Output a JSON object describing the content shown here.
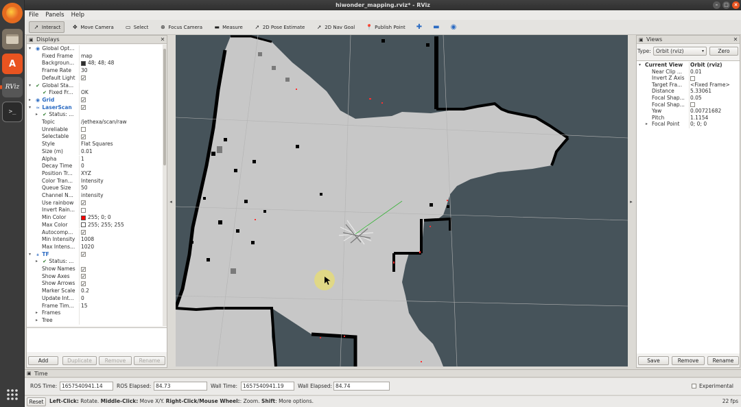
{
  "window": {
    "title": "hiwonder_mapping.rviz* - RViz"
  },
  "menu": [
    "File",
    "Panels",
    "Help"
  ],
  "toolbar": [
    {
      "label": "Interact",
      "icon": "cursor-icon",
      "glyph": "➚",
      "active": true
    },
    {
      "label": "Move Camera",
      "icon": "move-icon",
      "glyph": "✥",
      "active": false
    },
    {
      "label": "Select",
      "icon": "select-icon",
      "glyph": "▭",
      "active": false
    },
    {
      "label": "Focus Camera",
      "icon": "focus-icon",
      "glyph": "⊕",
      "active": false
    },
    {
      "label": "Measure",
      "icon": "ruler-icon",
      "glyph": "▬",
      "active": false
    },
    {
      "label": "2D Pose Estimate",
      "icon": "pose-arrow-icon",
      "glyph": "➚",
      "active": false
    },
    {
      "label": "2D Nav Goal",
      "icon": "goal-arrow-icon",
      "glyph": "➚",
      "active": false
    },
    {
      "label": "Publish Point",
      "icon": "pin-icon",
      "glyph": "📍",
      "active": false
    }
  ],
  "displays": {
    "title": "Displays",
    "rows": [
      {
        "indent": 0,
        "arrow": "▾",
        "icon": "◉",
        "label": "Global Opt...",
        "value": "",
        "kind": "text"
      },
      {
        "indent": 1,
        "label": "Fixed Frame",
        "value": "map",
        "kind": "text"
      },
      {
        "indent": 1,
        "label": "Backgroun...",
        "value": "48; 48; 48",
        "kind": "color",
        "color": "#303030"
      },
      {
        "indent": 1,
        "label": "Frame Rate",
        "value": "30",
        "kind": "text"
      },
      {
        "indent": 1,
        "label": "Default Light",
        "value": "",
        "kind": "check",
        "checked": true
      },
      {
        "indent": 0,
        "arrow": "▾",
        "icon": "✔",
        "label": "Global Sta...",
        "value": "",
        "kind": "text"
      },
      {
        "indent": 1,
        "icon": "✔",
        "label": "Fixed Fr...",
        "value": "OK",
        "kind": "text"
      },
      {
        "indent": 0,
        "arrow": "▸",
        "icon": "◉",
        "label": "Grid",
        "value": "",
        "kind": "check",
        "checked": true,
        "blue": true
      },
      {
        "indent": 0,
        "arrow": "▾",
        "icon": "≈",
        "label": "LaserScan",
        "value": "",
        "kind": "check",
        "checked": true,
        "blue": true
      },
      {
        "indent": 1,
        "arrow": "▸",
        "icon": "✔",
        "label": "Status: ...",
        "value": "",
        "kind": "text"
      },
      {
        "indent": 1,
        "label": "Topic",
        "value": "/jethexa/scan/raw",
        "kind": "text"
      },
      {
        "indent": 1,
        "label": "Unreliable",
        "value": "",
        "kind": "check",
        "checked": false
      },
      {
        "indent": 1,
        "label": "Selectable",
        "value": "",
        "kind": "check",
        "checked": true
      },
      {
        "indent": 1,
        "label": "Style",
        "value": "Flat Squares",
        "kind": "text"
      },
      {
        "indent": 1,
        "label": "Size (m)",
        "value": "0.01",
        "kind": "text"
      },
      {
        "indent": 1,
        "label": "Alpha",
        "value": "1",
        "kind": "text"
      },
      {
        "indent": 1,
        "label": "Decay Time",
        "value": "0",
        "kind": "text"
      },
      {
        "indent": 1,
        "label": "Position Tr...",
        "value": "XYZ",
        "kind": "text"
      },
      {
        "indent": 1,
        "label": "Color Tran...",
        "value": "Intensity",
        "kind": "text"
      },
      {
        "indent": 1,
        "label": "Queue Size",
        "value": "50",
        "kind": "text"
      },
      {
        "indent": 1,
        "label": "Channel N...",
        "value": "intensity",
        "kind": "text"
      },
      {
        "indent": 1,
        "label": "Use rainbow",
        "value": "",
        "kind": "check",
        "checked": true
      },
      {
        "indent": 1,
        "label": "Invert Rain...",
        "value": "",
        "kind": "check",
        "checked": false
      },
      {
        "indent": 1,
        "label": "Min Color",
        "value": "255; 0; 0",
        "kind": "color",
        "color": "#ff0000"
      },
      {
        "indent": 1,
        "label": "Max Color",
        "value": "255; 255; 255",
        "kind": "color",
        "color": "#ffffff"
      },
      {
        "indent": 1,
        "label": "Autocomp...",
        "value": "",
        "kind": "check",
        "checked": true
      },
      {
        "indent": 1,
        "label": "Min Intensity",
        "value": "1008",
        "kind": "text"
      },
      {
        "indent": 1,
        "label": "Max Intens...",
        "value": "1020",
        "kind": "text"
      },
      {
        "indent": 0,
        "arrow": "▾",
        "icon": "⚹",
        "label": "TF",
        "value": "",
        "kind": "check",
        "checked": true,
        "blue": true
      },
      {
        "indent": 1,
        "arrow": "▸",
        "icon": "✔",
        "label": "Status: ...",
        "value": "",
        "kind": "text"
      },
      {
        "indent": 1,
        "label": "Show Names",
        "value": "",
        "kind": "check",
        "checked": true
      },
      {
        "indent": 1,
        "label": "Show Axes",
        "value": "",
        "kind": "check",
        "checked": true
      },
      {
        "indent": 1,
        "label": "Show Arrows",
        "value": "",
        "kind": "check",
        "checked": true
      },
      {
        "indent": 1,
        "label": "Marker Scale",
        "value": "0.2",
        "kind": "text"
      },
      {
        "indent": 1,
        "label": "Update Int...",
        "value": "0",
        "kind": "text"
      },
      {
        "indent": 1,
        "label": "Frame Tim...",
        "value": "15",
        "kind": "text"
      },
      {
        "indent": 1,
        "arrow": "▸",
        "label": "Frames",
        "value": "",
        "kind": "text"
      },
      {
        "indent": 1,
        "arrow": "▸",
        "label": "Tree",
        "value": "",
        "kind": "text"
      }
    ],
    "buttons": {
      "add": "Add",
      "duplicate": "Duplicate",
      "remove": "Remove",
      "rename": "Rename"
    }
  },
  "views": {
    "title": "Views",
    "type_label": "Type:",
    "type_value": "Orbit (rviz)",
    "zero": "Zero",
    "rows": [
      {
        "indent": 0,
        "arrow": "▾",
        "label": "Current View",
        "value": "Orbit (rviz)",
        "kind": "text",
        "bold": true
      },
      {
        "indent": 1,
        "label": "Near Clip ...",
        "value": "0.01",
        "kind": "text"
      },
      {
        "indent": 1,
        "label": "Invert Z Axis",
        "value": "",
        "kind": "check",
        "checked": false
      },
      {
        "indent": 1,
        "label": "Target Fra...",
        "value": "<Fixed Frame>",
        "kind": "text"
      },
      {
        "indent": 1,
        "label": "Distance",
        "value": "5.33061",
        "kind": "text"
      },
      {
        "indent": 1,
        "label": "Focal Shap...",
        "value": "0.05",
        "kind": "text"
      },
      {
        "indent": 1,
        "label": "Focal Shap...",
        "value": "",
        "kind": "check",
        "checked": false
      },
      {
        "indent": 1,
        "label": "Yaw",
        "value": "0.00721682",
        "kind": "text"
      },
      {
        "indent": 1,
        "label": "Pitch",
        "value": "1.1154",
        "kind": "text"
      },
      {
        "indent": 1,
        "arrow": "▸",
        "label": "Focal Point",
        "value": "0; 0; 0",
        "kind": "text"
      }
    ],
    "buttons": {
      "save": "Save",
      "remove": "Remove",
      "rename": "Rename"
    }
  },
  "time": {
    "title": "Time",
    "ros_time_label": "ROS Time:",
    "ros_time": "1657540941.14",
    "ros_elapsed_label": "ROS Elapsed:",
    "ros_elapsed": "84.73",
    "wall_time_label": "Wall Time:",
    "wall_time": "1657540941.19",
    "wall_elapsed_label": "Wall Elapsed:",
    "wall_elapsed": "84.74",
    "experimental": "Experimental"
  },
  "status": {
    "reset": "Reset",
    "lc_key": "Left-Click:",
    "lc_text": " Rotate. ",
    "mc_key": "Middle-Click:",
    "mc_text": " Move X/Y. ",
    "rc_key": "Right-Click/Mouse Wheel:",
    "rc_text": ": Zoom. ",
    "shift_key": "Shift",
    "shift_text": ": More options.",
    "fps": "22 fps"
  },
  "dock": [
    {
      "name": "firefox-icon",
      "color": "#e66000",
      "glyph": "◉"
    },
    {
      "name": "files-icon",
      "color": "#8a7f72",
      "glyph": "▤"
    },
    {
      "name": "software-center-icon",
      "color": "#e95420",
      "glyph": "A"
    },
    {
      "name": "rviz-icon",
      "color": "#4a4a4a",
      "glyph": "RViz"
    },
    {
      "name": "terminal-icon",
      "color": "#2d2d2d",
      "glyph": ">_"
    }
  ],
  "colors": {
    "free": "#c7c7c7",
    "unknown": "#46535a",
    "occupied": "#000000",
    "laser": "#ff3030",
    "accent": "#e95420"
  }
}
